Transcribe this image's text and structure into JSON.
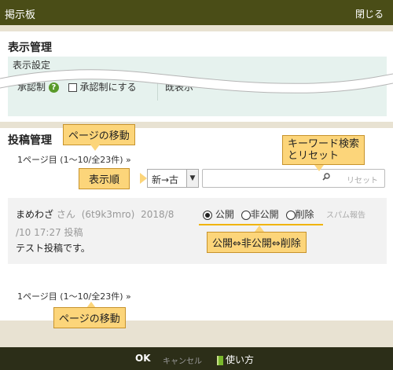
{
  "header": {
    "title": "掲示板",
    "close_label": "閉じる"
  },
  "display_section": {
    "heading": "表示管理",
    "settings_label": "表示設定",
    "approval_label": "承認制",
    "approval_checkbox_label": "承認制にする",
    "clipped_text": "既表示"
  },
  "posts_section": {
    "heading": "投稿管理",
    "pager_top": "1ページ目 (1〜10/全23件) »",
    "sort_value": "新→古",
    "reset_label": "リセット",
    "post": {
      "author": "まめわざ",
      "honorific": "さん",
      "user_id": "(6t9k3mro)",
      "date_line1": "2018/8",
      "date_line2": "/10 17:27 投稿",
      "body": "テスト投稿です。",
      "options": [
        "公開",
        "非公開",
        "削除"
      ],
      "selected_option": "公開",
      "spam_label": "スパム報告"
    },
    "pager_bottom": "1ページ目 (1〜10/全23件) »"
  },
  "footer": {
    "ok_label": "OK",
    "cancel_label": "キャンセル",
    "howto_label": "使い方"
  },
  "annotations": {
    "page_move_top": "ページの移動",
    "sort_order": "表示順",
    "keyword_search_line1": "キーワード検索",
    "keyword_search_line2": "とリセット",
    "publish_toggle": "公開⇔非公開⇔削除",
    "page_move_bottom": "ページの移動"
  },
  "colors": {
    "topbar": "#4a4d17",
    "callout": "#fcd57a",
    "callout_border": "#c7932c",
    "settings_bg": "#e6f2ee"
  }
}
